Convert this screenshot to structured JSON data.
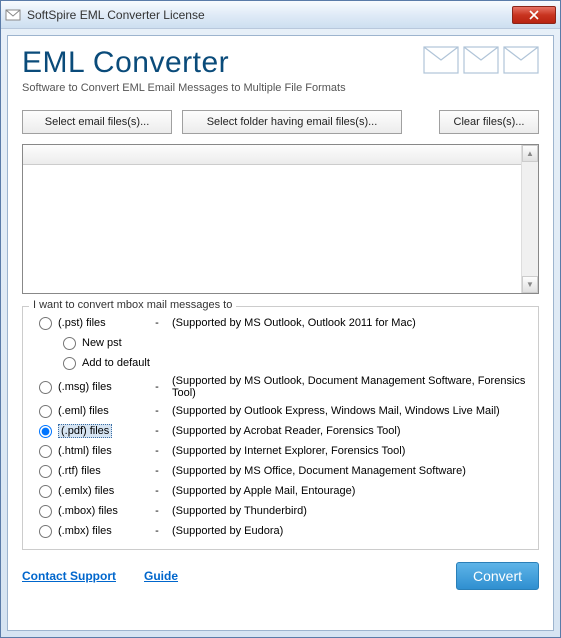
{
  "window": {
    "title": "SoftSpire EML Converter License"
  },
  "header": {
    "app_title": "EML Converter",
    "subtitle": "Software to Convert EML Email Messages to Multiple File Formats"
  },
  "buttons": {
    "select_email": "Select email files(s)...",
    "select_folder": "Select folder having email files(s)...",
    "clear": "Clear files(s)..."
  },
  "group": {
    "label": "I want to convert mbox mail messages to"
  },
  "options": {
    "pst": {
      "label": "(.pst) files",
      "dash": "-",
      "desc": "(Supported by MS Outlook, Outlook 2011 for Mac)"
    },
    "pst_new": {
      "label": "New pst"
    },
    "pst_add": {
      "label": "Add to default"
    },
    "msg": {
      "label": "(.msg) files",
      "dash": "-",
      "desc": "(Supported by MS Outlook, Document Management Software, Forensics Tool)"
    },
    "eml": {
      "label": "(.eml) files",
      "dash": "-",
      "desc": "(Supported by Outlook Express,  Windows Mail, Windows Live Mail)"
    },
    "pdf": {
      "label": "(.pdf) files",
      "dash": "-",
      "desc": "(Supported by Acrobat Reader, Forensics Tool)"
    },
    "html": {
      "label": "(.html) files",
      "dash": "-",
      "desc": "(Supported by Internet Explorer, Forensics Tool)"
    },
    "rtf": {
      "label": "(.rtf) files",
      "dash": "-",
      "desc": "(Supported by MS Office, Document Management Software)"
    },
    "emlx": {
      "label": "(.emlx) files",
      "dash": "-",
      "desc": "(Supported by Apple Mail, Entourage)"
    },
    "mbox": {
      "label": "(.mbox) files",
      "dash": "-",
      "desc": "(Supported by Thunderbird)"
    },
    "mbx": {
      "label": "(.mbx) files",
      "dash": "-",
      "desc": "(Supported by Eudora)"
    }
  },
  "footer": {
    "support": "Contact Support",
    "guide": "Guide",
    "convert": "Convert"
  }
}
